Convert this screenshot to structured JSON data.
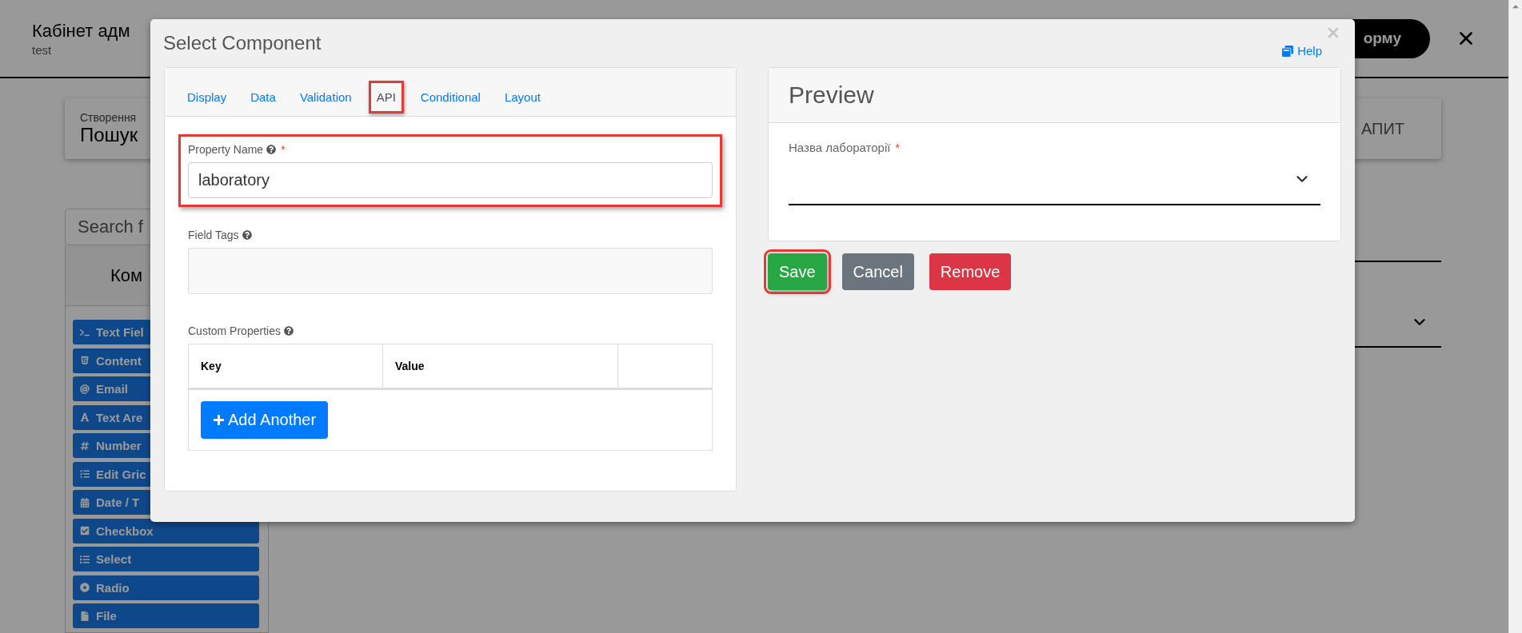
{
  "background": {
    "header": {
      "title": "Кабінет адм",
      "subtitle": "test",
      "button": "орму"
    },
    "card": {
      "caption": "Створення",
      "title": "Пошук",
      "action": "АПИТ"
    },
    "search": {
      "placeholder": "Search f"
    },
    "sidebar": {
      "title": "Ком",
      "items": [
        {
          "label": "Text Fiel",
          "kind": "terminal"
        },
        {
          "label": "Content",
          "kind": "html"
        },
        {
          "label": "Email",
          "kind": "at"
        },
        {
          "label": "Text Are",
          "kind": "font"
        },
        {
          "label": "Number",
          "kind": "hash"
        },
        {
          "label": "Edit Gric",
          "kind": "grid"
        },
        {
          "label": "Date / T",
          "kind": "calendar"
        },
        {
          "label": "Checkbox",
          "kind": "check"
        },
        {
          "label": "Select",
          "kind": "list"
        },
        {
          "label": "Radio",
          "kind": "radio"
        },
        {
          "label": "File",
          "kind": "file"
        }
      ]
    }
  },
  "modal": {
    "title": "Select Component",
    "help": "Help",
    "tabs": [
      {
        "label": "Display",
        "selected": false,
        "highlighted": false
      },
      {
        "label": "Data",
        "selected": false,
        "highlighted": false
      },
      {
        "label": "Validation",
        "selected": false,
        "highlighted": false
      },
      {
        "label": "API",
        "selected": true,
        "highlighted": true
      },
      {
        "label": "Conditional",
        "selected": false,
        "highlighted": false
      },
      {
        "label": "Layout",
        "selected": false,
        "highlighted": false
      }
    ],
    "property_name": {
      "label": "Property Name",
      "required_mark": "*",
      "value": "laboratory",
      "highlighted": true
    },
    "field_tags": {
      "label": "Field Tags"
    },
    "custom_properties": {
      "label": "Custom Properties",
      "columns": [
        "Key",
        "Value"
      ],
      "add_button": "Add Another"
    },
    "preview": {
      "title": "Preview",
      "field_label": "Назва лабораторії",
      "required_mark": "*"
    },
    "buttons": [
      {
        "label": "Save",
        "kind": "success",
        "highlighted": true
      },
      {
        "label": "Cancel",
        "kind": "secondary",
        "highlighted": false
      },
      {
        "label": "Remove",
        "kind": "danger",
        "highlighted": false
      }
    ]
  }
}
